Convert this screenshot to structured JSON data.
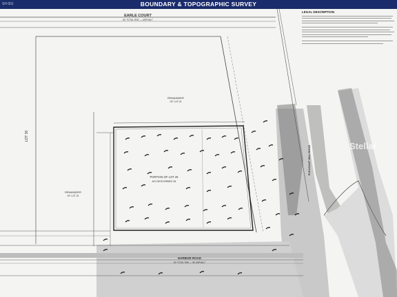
{
  "header": {
    "title": "BOUNDARY & TOPOGRAPHIC SURVEY",
    "sheet": "SH 001",
    "bar_color": "#1a2c6b"
  },
  "streets": {
    "north": "EARLE COURT",
    "north_sub": "60' TOTAL R/W — ASPHALT",
    "south": "HARBOR ROAD",
    "south_sub": "60' TOTAL R/W — 36' ASPHALT",
    "east": "PLEASANT HILL ROAD"
  },
  "labels": {
    "remainder_north": "REMAINDER",
    "remainder_north_sub": "OF LOT 24",
    "remainder_west": "REMAINDER",
    "remainder_west_sub": "OF LOT 24",
    "lot_west": "LOT 30",
    "portion_line1": "PORTION OF LOT 25",
    "portion_line2": "AS DESCRIBED IN"
  },
  "legal": {
    "title": "LEGAL DESCRIPTION"
  },
  "watermark": "Stellar"
}
